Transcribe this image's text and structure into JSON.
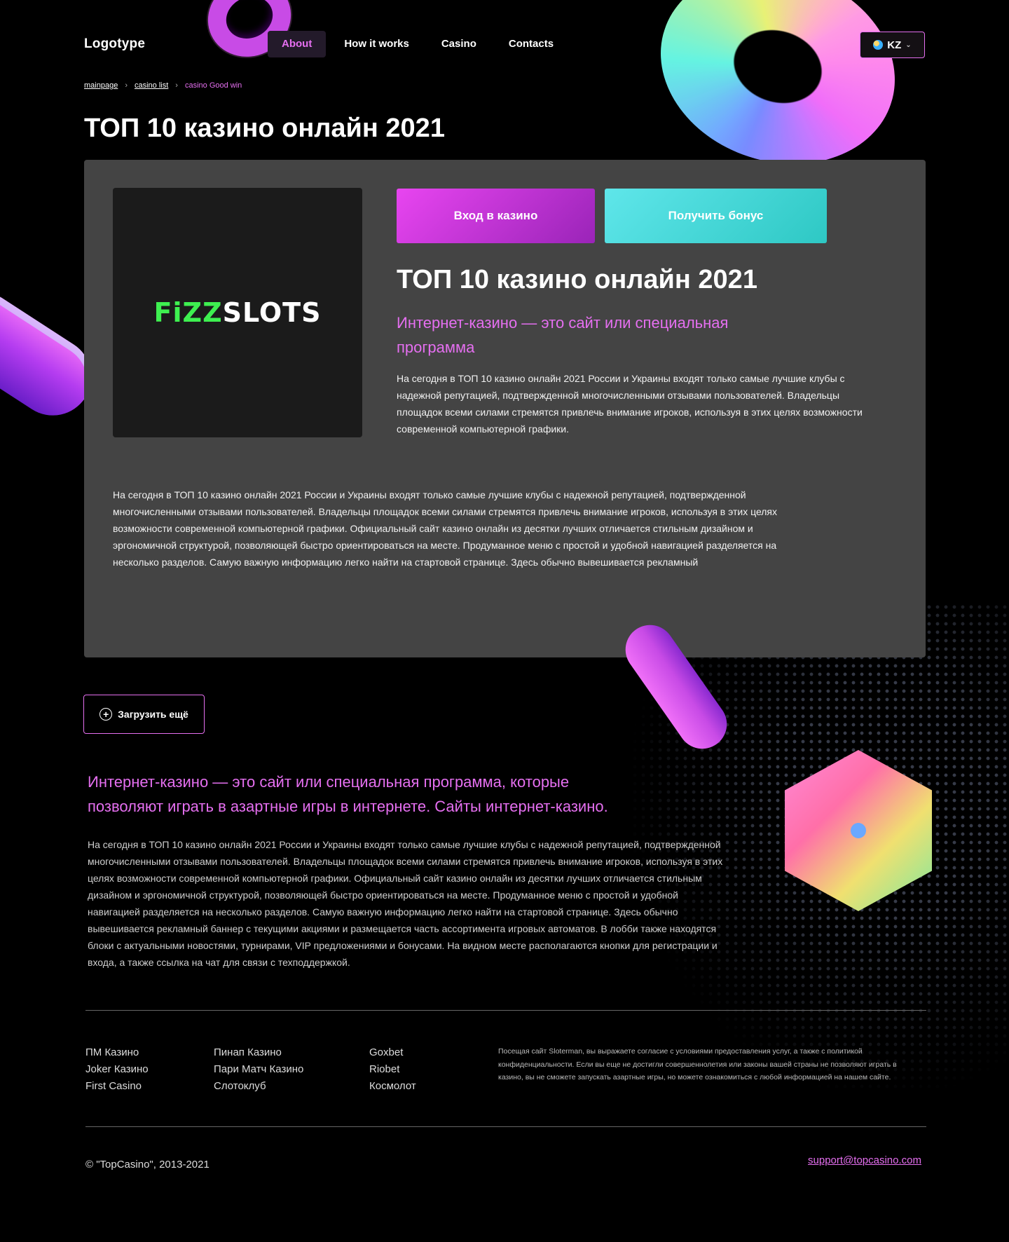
{
  "header": {
    "logo": "Logotype",
    "nav": [
      "About",
      "How it works",
      "Casino",
      "Contacts"
    ],
    "active_nav": "About",
    "lang": "KZ"
  },
  "breadcrumb": {
    "items": [
      "mainpage",
      "casino list"
    ],
    "current": "casino Good win"
  },
  "page_title": "ТОП 10 казино онлайн 2021",
  "card": {
    "brand_part1": "FiZZ",
    "brand_part2": "SLOTS",
    "enter_button": "Вход в казино",
    "bonus_button": "Получить бонус",
    "title": "ТОП 10 казино онлайн 2021",
    "subtitle": "Интернет-казино — это сайт или специальная программа",
    "text": "На сегодня в ТОП 10 казино онлайн 2021 России и Украины входят только самые лучшие клубы с надежной репутацией, подтвержденной многочисленными отзывами пользователей. Владельцы площадок всеми силами стремятся привлечь внимание игроков, используя в этих целях возможности современной компьютерной графики.",
    "long_text": "На сегодня в ТОП 10 казино онлайн 2021 России и Украины входят только самые лучшие клубы с надежной репутацией, подтвержденной многочисленными отзывами пользователей. Владельцы площадок всеми силами стремятся привлечь внимание игроков, используя в этих целях возможности современной компьютерной графики. Официальный сайт казино онлайн из десятки лучших отличается стильным дизайном и эргономичной структурой, позволяющей быстро ориентироваться на месте. Продуманное меню с простой и удобной навигацией разделяется на несколько разделов. Самую важную информацию легко найти на стартовой странице. Здесь обычно вывешивается рекламный"
  },
  "load_more": "Загрузить ещё",
  "section": {
    "subtitle": "Интернет-казино — это сайт или специальная программа, которые позволяют играть в азартные игры в интернете. Сайты интернет-казино.",
    "text": "На сегодня в ТОП 10 казино онлайн 2021 России и Украины входят только самые лучшие клубы с надежной репутацией, подтвержденной многочисленными отзывами пользователей. Владельцы площадок всеми силами стремятся привлечь внимание игроков, используя в этих целях возможности современной компьютерной графики. Официальный сайт казино онлайн из десятки лучших отличается стильным дизайном и эргономичной структурой, позволяющей быстро ориентироваться на месте. Продуманное меню с простой и удобной навигацией разделяется на несколько разделов. Самую важную информацию легко найти на стартовой странице. Здесь обычно вывешивается рекламный баннер с текущими акциями и размещается часть ассортимента игровых автоматов. В лобби также находятся блоки с актуальными новостями, турнирами, VIP предложениями и бонусами. На видном месте располагаются кнопки для регистрации и входа, а также ссылка на чат для связи с техподдержкой."
  },
  "footer": {
    "col1": [
      "ПМ Казино",
      "Joker Казино",
      "First Casino"
    ],
    "col2": [
      "Пинап Казино",
      "Пари Матч Казино",
      "Слотоклуб"
    ],
    "col3": [
      "Goxbet",
      "Riobet",
      "Космолот"
    ],
    "note": "Посещая сайт Sloterman, вы выражаете согласие с условиями предоставления услуг, а также с политикой конфиденциальности. Если вы еще не достигли совершеннолетия или законы вашей страны не позволяют играть в казино, вы не сможете запускать азартные игры, но можете ознакомиться с любой информацией на нашем сайте.",
    "copyright": "© \"TopCasino\", 2013-2021",
    "support": "support@topcasino.com"
  },
  "colors": {
    "accent": "#e56ff0",
    "teal": "#3fd8d6",
    "card_bg": "#444444",
    "bg": "#000000"
  }
}
